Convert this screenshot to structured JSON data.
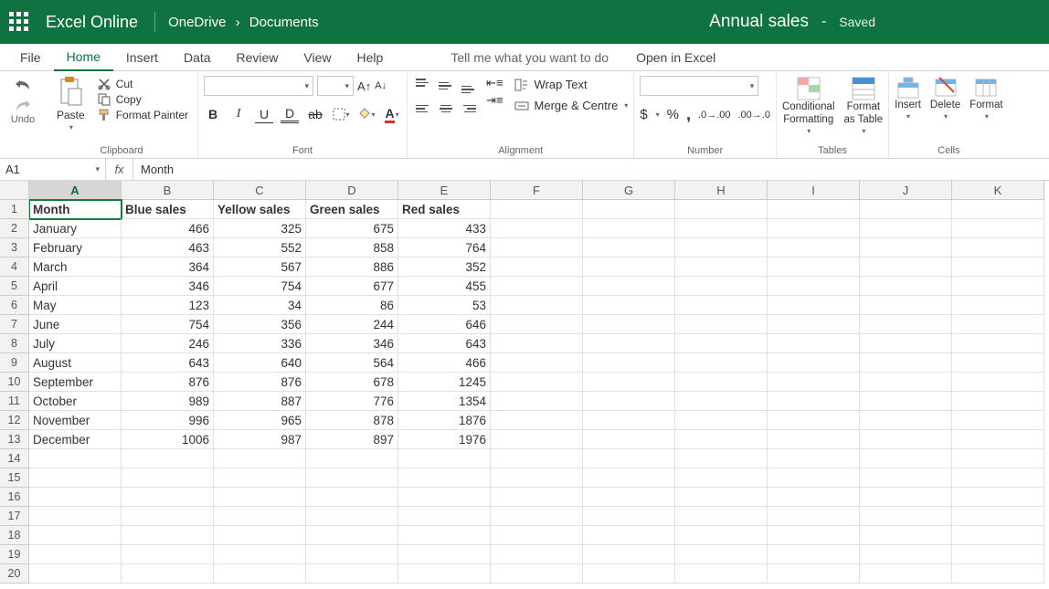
{
  "title": {
    "app": "Excel Online",
    "breadcrumb_root": "OneDrive",
    "breadcrumb_folder": "Documents",
    "doc": "Annual sales",
    "status_sep": "-",
    "status": "Saved"
  },
  "menu": {
    "file": "File",
    "home": "Home",
    "insert": "Insert",
    "data": "Data",
    "review": "Review",
    "view": "View",
    "help": "Help",
    "tellme": "Tell me what you want to do",
    "open_excel": "Open in Excel"
  },
  "ribbon": {
    "undo_label": "Undo",
    "paste": "Paste",
    "cut": "Cut",
    "copy": "Copy",
    "format_painter": "Format Painter",
    "clipboard_label": "Clipboard",
    "font_label": "Font",
    "alignment_label": "Alignment",
    "number_label": "Number",
    "tables_label": "Tables",
    "cells_label": "Cells",
    "wrap": "Wrap Text",
    "merge": "Merge & Centre",
    "cond_fmt": "Conditional\nFormatting",
    "fmt_table": "Format\nas Table",
    "insert": "Insert",
    "delete": "Delete",
    "format": "Format",
    "currency": "$",
    "percent": "%",
    "comma": ",",
    "inc_dec": "⁰₀←",
    "dec_dec": "→⁰₀"
  },
  "ref": {
    "cell": "A1",
    "formula": "Month"
  },
  "columns": [
    "A",
    "B",
    "C",
    "D",
    "E",
    "F",
    "G",
    "H",
    "I",
    "J",
    "K"
  ],
  "row_numbers": [
    1,
    2,
    3,
    4,
    5,
    6,
    7,
    8,
    9,
    10,
    11,
    12,
    13,
    14,
    15,
    16,
    17,
    18,
    19,
    20
  ],
  "table": {
    "headers": [
      "Month",
      "Blue sales",
      "Yellow sales",
      "Green sales",
      "Red sales"
    ],
    "rows": [
      [
        "January",
        466,
        325,
        675,
        433
      ],
      [
        "February",
        463,
        552,
        858,
        764
      ],
      [
        "March",
        364,
        567,
        886,
        352
      ],
      [
        "April",
        346,
        754,
        677,
        455
      ],
      [
        "May",
        123,
        34,
        86,
        53
      ],
      [
        "June",
        754,
        356,
        244,
        646
      ],
      [
        "July",
        246,
        336,
        346,
        643
      ],
      [
        "August",
        643,
        640,
        564,
        466
      ],
      [
        "September",
        876,
        876,
        678,
        1245
      ],
      [
        "October",
        989,
        887,
        776,
        1354
      ],
      [
        "November",
        996,
        965,
        878,
        1876
      ],
      [
        "December",
        1006,
        987,
        897,
        1976
      ]
    ]
  }
}
